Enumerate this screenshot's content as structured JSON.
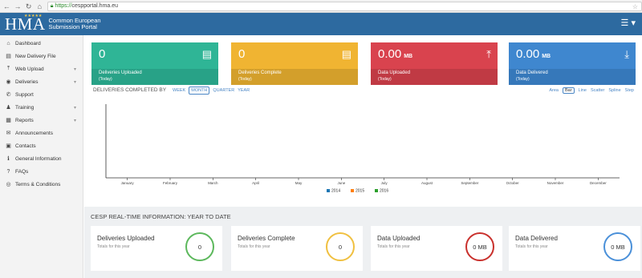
{
  "browser": {
    "url_scheme": "https://",
    "url_rest": "cespportal.hma.eu"
  },
  "header": {
    "logo_text": "HMA",
    "portal_line1": "Common European",
    "portal_line2": "Submission Portal"
  },
  "sidebar": {
    "items": [
      {
        "label": "Dashboard",
        "icon": "home-icon",
        "glyph": "⌂",
        "chevron": false
      },
      {
        "label": "New Delivery File",
        "icon": "file-icon",
        "glyph": "▤",
        "chevron": false
      },
      {
        "label": "Web Upload",
        "icon": "upload-icon",
        "glyph": "⤒",
        "chevron": true
      },
      {
        "label": "Deliveries",
        "icon": "deliveries-icon",
        "glyph": "◉",
        "chevron": true
      },
      {
        "label": "Support",
        "icon": "support-icon",
        "glyph": "✆",
        "chevron": false
      },
      {
        "label": "Training",
        "icon": "training-icon",
        "glyph": "♟",
        "chevron": true
      },
      {
        "label": "Reports",
        "icon": "reports-icon",
        "glyph": "▦",
        "chevron": true
      },
      {
        "label": "Announcements",
        "icon": "megaphone-icon",
        "glyph": "✉",
        "chevron": false
      },
      {
        "label": "Contacts",
        "icon": "contacts-icon",
        "glyph": "▣",
        "chevron": false
      },
      {
        "label": "General Information",
        "icon": "info-icon",
        "glyph": "ℹ",
        "chevron": false
      },
      {
        "label": "FAQs",
        "icon": "question-icon",
        "glyph": "?",
        "chevron": false
      },
      {
        "label": "Terms & Conditions",
        "icon": "eye-icon",
        "glyph": "◎",
        "chevron": false
      }
    ]
  },
  "tiles": [
    {
      "value": "0",
      "unit": "",
      "label": "Deliveries Uploaded",
      "sub": "(Today)",
      "color_top": "#2fb596",
      "color_bottom": "#28a287",
      "glyph": "▤",
      "icon": "document-icon"
    },
    {
      "value": "0",
      "unit": "",
      "label": "Deliveries Complete",
      "sub": "(Today)",
      "color_top": "#f0b432",
      "color_bottom": "#d39f2b",
      "glyph": "▤",
      "icon": "document-icon"
    },
    {
      "value": "0.00",
      "unit": "MB",
      "label": "Data Uploaded",
      "sub": "(Today)",
      "color_top": "#d9434e",
      "color_bottom": "#c03a44",
      "glyph": "⤒",
      "icon": "upload-icon"
    },
    {
      "value": "0.00",
      "unit": "MB",
      "label": "Data Delivered",
      "sub": "(Today)",
      "color_top": "#3f87cf",
      "color_bottom": "#3678ba",
      "glyph": "⤓",
      "icon": "download-icon"
    }
  ],
  "chart_controls": {
    "title": "DELIVERIES COMPLETED BY",
    "periods": [
      "WEEK",
      "MONTH",
      "QUARTER",
      "YEAR"
    ],
    "active_period": "MONTH",
    "types": [
      "Area",
      "Bar",
      "Line",
      "Scatter",
      "Spline",
      "Step"
    ],
    "active_type": "Bar"
  },
  "chart_data": {
    "type": "bar",
    "categories": [
      "January",
      "February",
      "March",
      "April",
      "May",
      "June",
      "July",
      "August",
      "September",
      "October",
      "November",
      "December"
    ],
    "series": [
      {
        "name": "2014",
        "color": "#1f77b4",
        "values": [
          0,
          0,
          0,
          0,
          0,
          0,
          0,
          0,
          0,
          0,
          0,
          0
        ]
      },
      {
        "name": "2015",
        "color": "#ff7f0e",
        "values": [
          0,
          0,
          0,
          0,
          0,
          0,
          0,
          0,
          0,
          0,
          0,
          0
        ]
      },
      {
        "name": "2016",
        "color": "#2ca02c",
        "values": [
          0,
          0,
          0,
          0,
          0,
          0,
          0,
          0,
          0,
          0,
          0,
          0
        ]
      }
    ],
    "title": "",
    "xlabel": "",
    "ylabel": "",
    "legend": "bottom"
  },
  "realtime": {
    "title": "CESP REAL-TIME INFORMATION: YEAR TO DATE",
    "cards": [
      {
        "label": "Deliveries Uploaded",
        "sub": "Totals for this year",
        "value": "0",
        "ring_color": "#5cb85c"
      },
      {
        "label": "Deliveries Complete",
        "sub": "Totals for this year",
        "value": "0",
        "ring_color": "#f0c040"
      },
      {
        "label": "Data Uploaded",
        "sub": "Totals for this year",
        "value": "0 MB",
        "ring_color": "#c9302c"
      },
      {
        "label": "Data Delivered",
        "sub": "Totals for this year",
        "value": "0 MB",
        "ring_color": "#4a90d9"
      }
    ]
  }
}
